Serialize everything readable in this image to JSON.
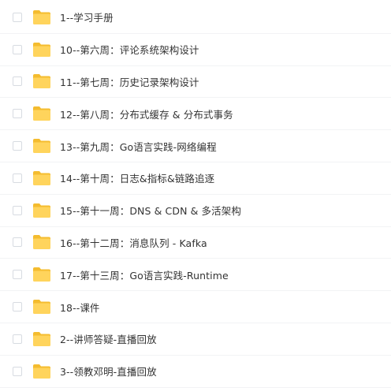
{
  "colors": {
    "folder_body": "#FFD45C",
    "folder_tab": "#F4BC2F",
    "text": "#333333",
    "checkbox_border": "#D7DBE1",
    "row_divider": "#F2F3F5"
  },
  "items": [
    {
      "label": "1--学习手册",
      "icon": "folder-icon"
    },
    {
      "label": "10--第六周：评论系统架构设计",
      "icon": "folder-icon"
    },
    {
      "label": "11--第七周：历史记录架构设计",
      "icon": "folder-icon"
    },
    {
      "label": "12--第八周：分布式缓存 & 分布式事务",
      "icon": "folder-icon"
    },
    {
      "label": "13--第九周：Go语言实践-网络编程",
      "icon": "folder-icon"
    },
    {
      "label": "14--第十周：日志&指标&链路追逐",
      "icon": "folder-icon"
    },
    {
      "label": "15--第十一周：DNS & CDN & 多活架构",
      "icon": "folder-icon"
    },
    {
      "label": "16--第十二周：消息队列 - Kafka",
      "icon": "folder-icon"
    },
    {
      "label": "17--第十三周：Go语言实践-Runtime",
      "icon": "folder-icon"
    },
    {
      "label": "18--课件",
      "icon": "folder-icon"
    },
    {
      "label": "2--讲师答疑-直播回放",
      "icon": "folder-icon"
    },
    {
      "label": "3--领教邓明-直播回放",
      "icon": "folder-icon"
    }
  ]
}
